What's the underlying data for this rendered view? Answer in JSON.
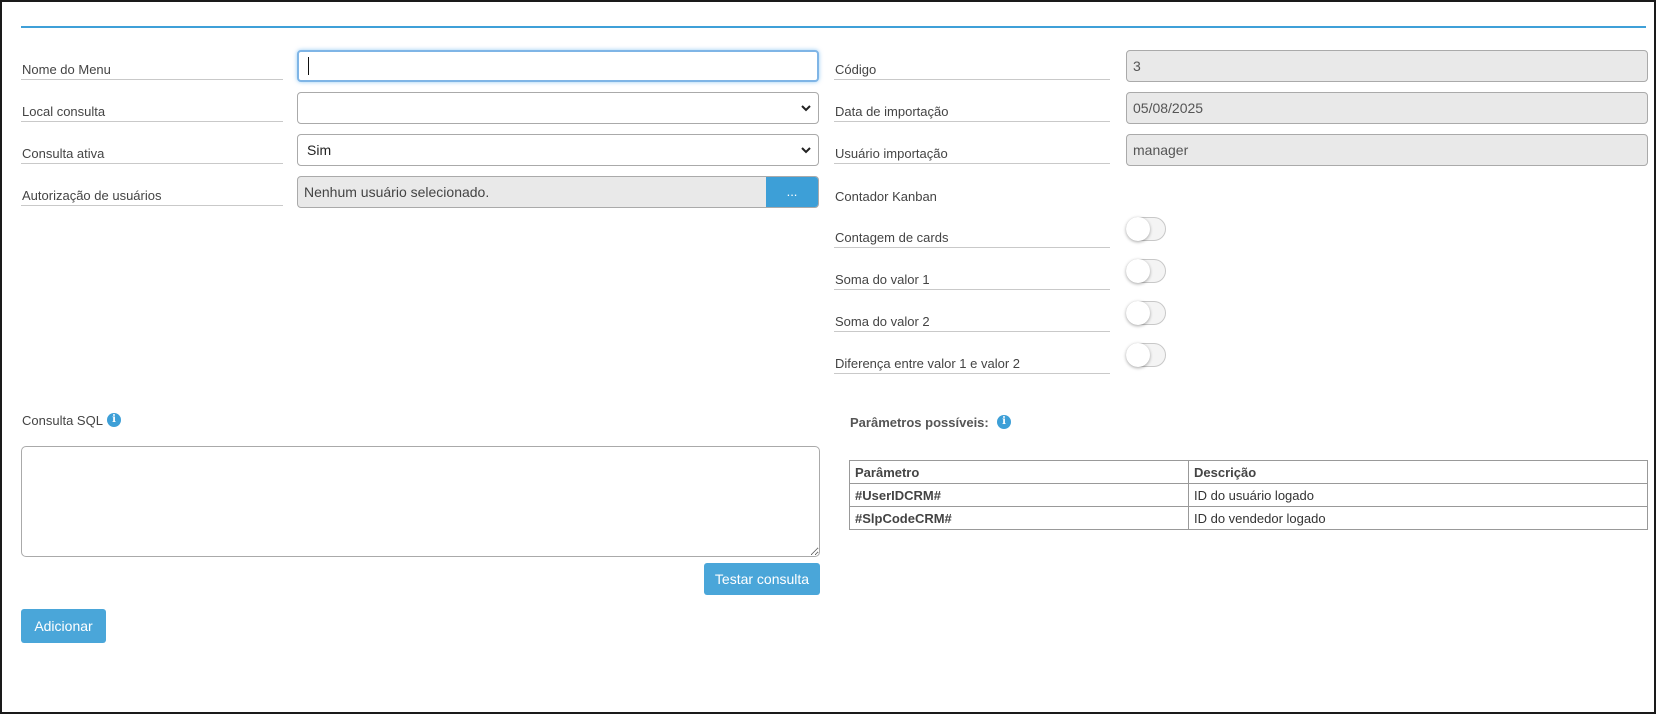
{
  "form": {
    "menu_name_label": "Nome do Menu",
    "menu_name_value": "",
    "local_consulta_label": "Local consulta",
    "local_consulta_value": "",
    "consulta_ativa_label": "Consulta ativa",
    "consulta_ativa_value": "Sim",
    "autorizacao_label": "Autorização de usuários",
    "autorizacao_value": "Nenhum usuário selecionado.",
    "autorizacao_button": "...",
    "codigo_label": "Código",
    "codigo_value": "3",
    "data_importacao_label": "Data de importação",
    "data_importacao_value": "05/08/2025",
    "usuario_importacao_label": "Usuário importação",
    "usuario_importacao_value": "manager",
    "contador_kanban_label": "Contador Kanban",
    "toggles": [
      {
        "label": "Contagem de cards",
        "on": false
      },
      {
        "label": "Soma do valor 1",
        "on": false
      },
      {
        "label": "Soma do valor 2",
        "on": false
      },
      {
        "label": "Diferença entre valor 1 e valor 2",
        "on": false
      }
    ]
  },
  "sql": {
    "label": "Consulta SQL",
    "value": "",
    "test_button": "Testar consulta"
  },
  "params": {
    "title": "Parâmetros possíveis:",
    "headers": [
      "Parâmetro",
      "Descrição"
    ],
    "rows": [
      {
        "param": "#UserIDCRM#",
        "desc": "ID do usuário logado"
      },
      {
        "param": "#SlpCodeCRM#",
        "desc": "ID do vendedor logado"
      }
    ]
  },
  "actions": {
    "add_button": "Adicionar"
  },
  "colors": {
    "accent": "#3d9fd7",
    "readonly_bg": "#e9e9e9"
  }
}
